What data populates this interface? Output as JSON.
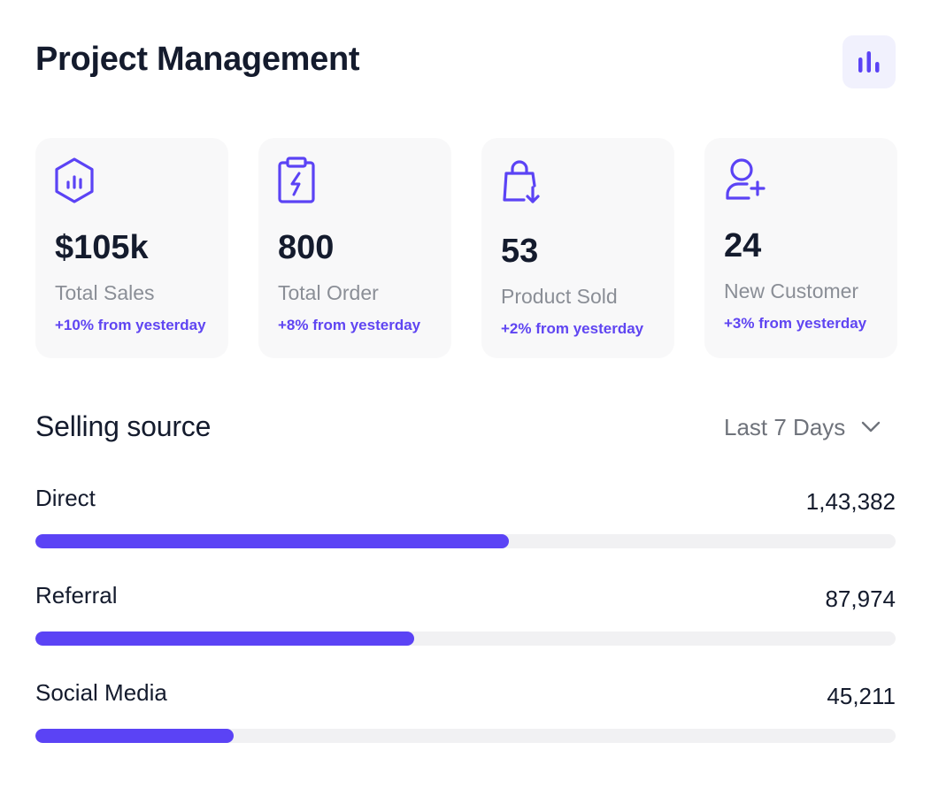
{
  "header": {
    "title": "Project Management",
    "chart_icon": "bar-chart-icon"
  },
  "colors": {
    "accent": "#5B43F5",
    "card_bg": "#F8F8F9",
    "muted_text": "#8A8E96",
    "track": "#F1F1F3"
  },
  "stats": [
    {
      "icon": "hexagon-chart-icon",
      "value": "$105k",
      "label": "Total Sales",
      "delta": "+10% from yesterday"
    },
    {
      "icon": "clipboard-bolt-icon",
      "value": "800",
      "label": "Total Order",
      "delta": "+8% from yesterday"
    },
    {
      "icon": "shopping-bag-download-icon",
      "value": "53",
      "label": "Product Sold",
      "delta": "+2% from yesterday"
    },
    {
      "icon": "user-add-icon",
      "value": "24",
      "label": "New Customer",
      "delta": "+3% from yesterday"
    }
  ],
  "selling_source": {
    "title": "Selling source",
    "range": {
      "selected": "Last 7 Days",
      "icon": "chevron-down-icon"
    },
    "sources": [
      {
        "name": "Direct",
        "value": "1,43,382",
        "progress": 0.55
      },
      {
        "name": "Referral",
        "value": "87,974",
        "progress": 0.44
      },
      {
        "name": "Social Media",
        "value": "45,211",
        "progress": 0.23
      }
    ]
  }
}
